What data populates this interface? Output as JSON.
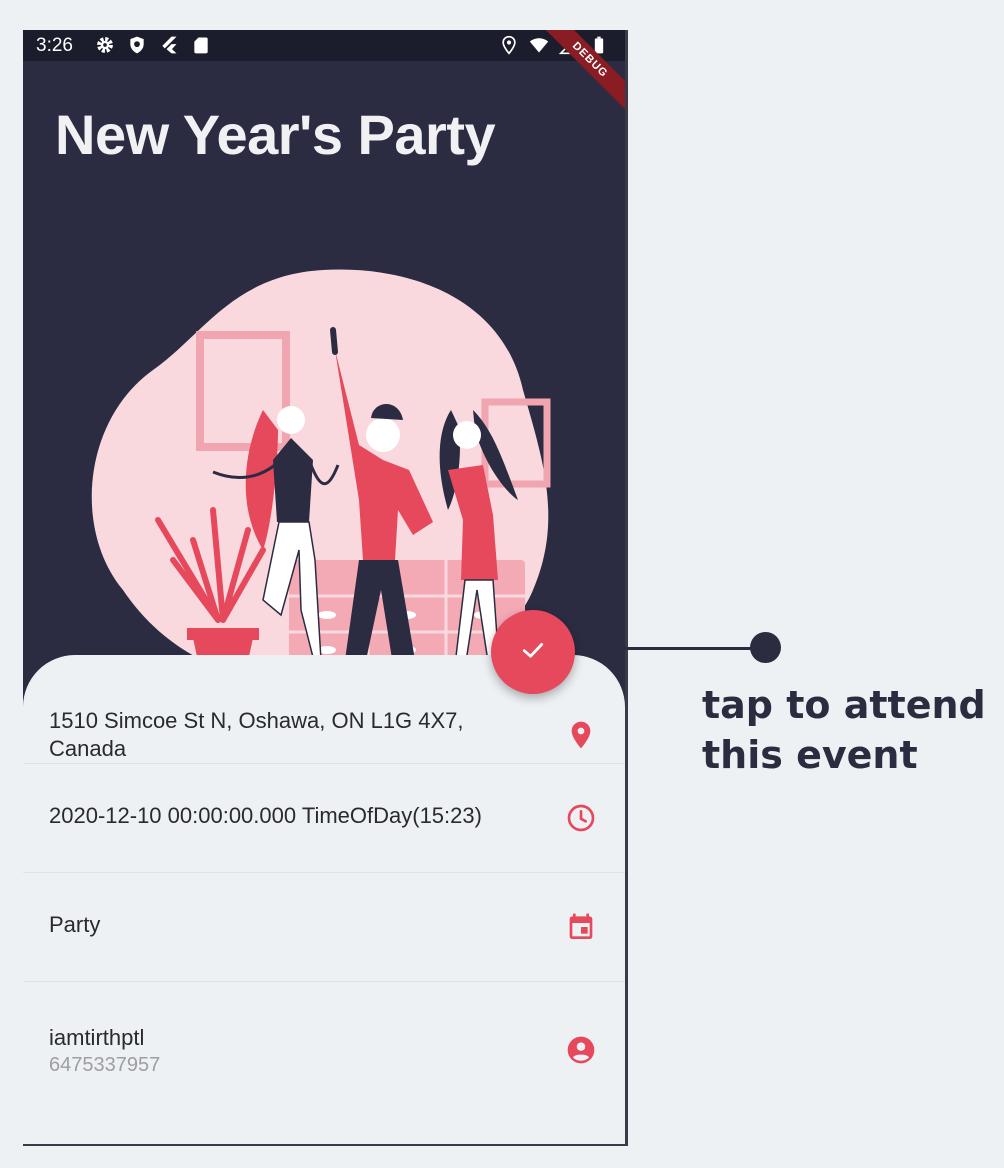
{
  "status_bar": {
    "time": "3:26",
    "left_icons": [
      "gear-icon",
      "shield-icon",
      "flutter-icon",
      "sd-card-icon"
    ],
    "right_icons": [
      "location-icon",
      "wifi-icon",
      "signal-icon",
      "battery-icon"
    ],
    "debug_banner": "DEBUG"
  },
  "event": {
    "title": "New Year's Party",
    "address": "1510 Simcoe St N, Oshawa, ON L1G 4X7, Canada",
    "datetime": "2020-12-10 00:00:00.000 TimeOfDay(15:23)",
    "category": "Party",
    "host_name": "iamtirthptl",
    "host_phone": "6475337957"
  },
  "icons": {
    "address": "location-pin-icon",
    "datetime": "clock-icon",
    "category": "calendar-icon",
    "host": "account-circle-icon",
    "fab": "check-icon"
  },
  "callout": {
    "text": "tap to attend this event"
  },
  "colors": {
    "accent": "#e6485c",
    "header_bg": "#2b2c42",
    "sheet_bg": "#eef1f4",
    "blob": "#f9d8de"
  }
}
